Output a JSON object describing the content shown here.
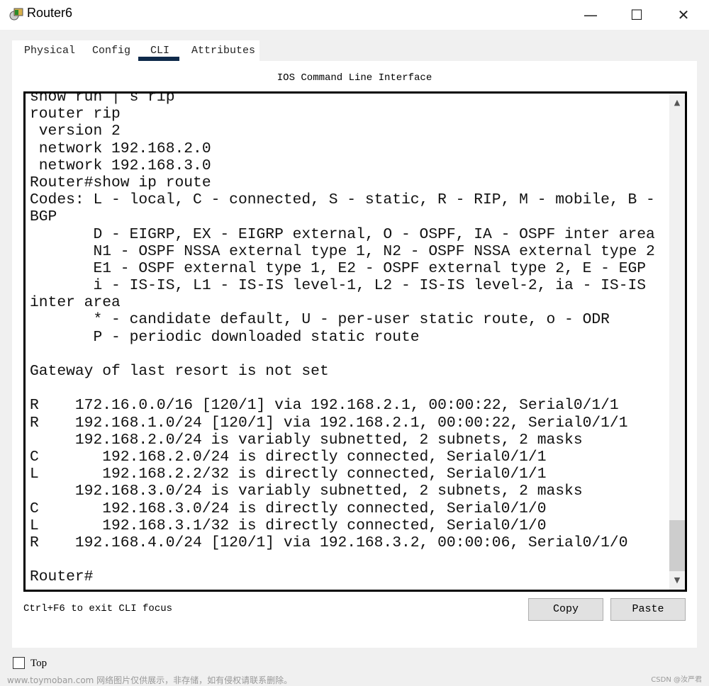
{
  "window": {
    "title": "Router6",
    "minimize": "—",
    "maximize": "☐",
    "close": "✕"
  },
  "tabs": [
    {
      "label": "Physical"
    },
    {
      "label": "Config"
    },
    {
      "label": "CLI",
      "active": true
    },
    {
      "label": "Attributes"
    }
  ],
  "cli": {
    "header": "IOS Command Line Interface",
    "lines": [
      "show run | s rip",
      "router rip",
      " version 2",
      " network 192.168.2.0",
      " network 192.168.3.0",
      "Router#show ip route",
      "Codes: L - local, C - connected, S - static, R - RIP, M - mobile, B -",
      "BGP",
      "       D - EIGRP, EX - EIGRP external, O - OSPF, IA - OSPF inter area",
      "       N1 - OSPF NSSA external type 1, N2 - OSPF NSSA external type 2",
      "       E1 - OSPF external type 1, E2 - OSPF external type 2, E - EGP",
      "       i - IS-IS, L1 - IS-IS level-1, L2 - IS-IS level-2, ia - IS-IS",
      "inter area",
      "       * - candidate default, U - per-user static route, o - ODR",
      "       P - periodic downloaded static route",
      "",
      "Gateway of last resort is not set",
      "",
      "R    172.16.0.0/16 [120/1] via 192.168.2.1, 00:00:22, Serial0/1/1",
      "R    192.168.1.0/24 [120/1] via 192.168.2.1, 00:00:22, Serial0/1/1",
      "     192.168.2.0/24 is variably subnetted, 2 subnets, 2 masks",
      "C       192.168.2.0/24 is directly connected, Serial0/1/1",
      "L       192.168.2.2/32 is directly connected, Serial0/1/1",
      "     192.168.3.0/24 is variably subnetted, 2 subnets, 2 masks",
      "C       192.168.3.0/24 is directly connected, Serial0/1/0",
      "L       192.168.3.1/32 is directly connected, Serial0/1/0",
      "R    192.168.4.0/24 [120/1] via 192.168.3.2, 00:00:06, Serial0/1/0",
      "",
      "Router#"
    ],
    "hint": "Ctrl+F6 to exit CLI focus",
    "copy": "Copy",
    "paste": "Paste"
  },
  "top_checkbox": {
    "label": "Top",
    "checked": false
  },
  "watermark_left": "www.toymoban.com 网络图片仅供展示，非存储，如有侵权请联系删除。",
  "watermark_right": "CSDN @汝严君"
}
